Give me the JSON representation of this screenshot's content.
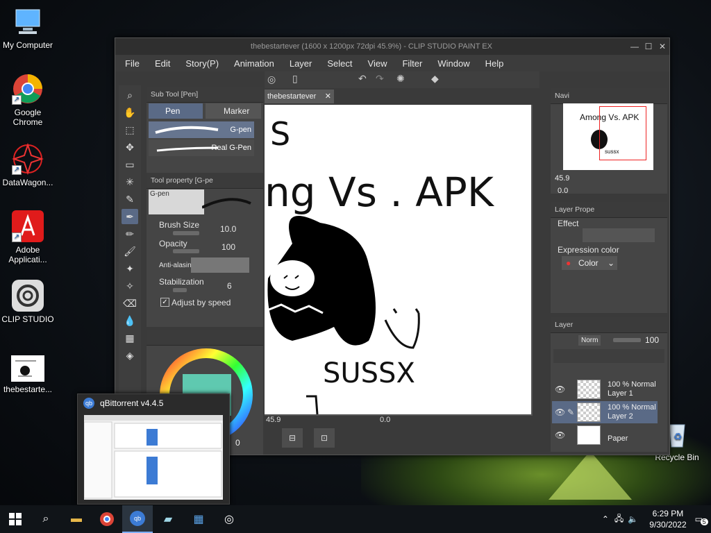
{
  "desktop": {
    "icons": [
      {
        "label": "My Computer",
        "icon": "computer-icon"
      },
      {
        "label": "Google Chrome",
        "icon": "chrome-icon"
      },
      {
        "label": "DataWagon...",
        "icon": "datawagon-icon"
      },
      {
        "label": "Adobe Applicati...",
        "icon": "adobe-icon"
      },
      {
        "label": "CLIP STUDIO",
        "icon": "clip-studio-icon"
      },
      {
        "label": "thebestarte...",
        "icon": "image-file-icon"
      },
      {
        "label": "Recycle Bin",
        "icon": "recycle-bin-icon"
      }
    ]
  },
  "window": {
    "title": "thebestartever (1600 x 1200px 72dpi 45.9%) - CLIP STUDIO PAINT EX",
    "menu": [
      "File",
      "Edit",
      "Story(P)",
      "Animation",
      "Layer",
      "Select",
      "View",
      "Filter",
      "Window",
      "Help"
    ]
  },
  "subtool": {
    "header": "Sub Tool [Pen]",
    "tabs": [
      "Pen",
      "Marker"
    ],
    "brushes": [
      "G-pen",
      "Real G-Pen"
    ]
  },
  "toolprop": {
    "header": "Tool property [G-pe",
    "brush_name": "G-pen",
    "brush_size_label": "Brush Size",
    "brush_size_value": "10.0",
    "opacity_label": "Opacity",
    "opacity_value": "100",
    "antialias_label": "Anti-alasin",
    "stabilization_label": "Stabilization",
    "stabilization_value": "6",
    "adjust_label": "Adjust by speed"
  },
  "canvas": {
    "tab": "thebestartever",
    "zoom": "45.9",
    "angle": "0.0",
    "drawing_text": [
      "S",
      "ng Vs . APK",
      "SUSSX"
    ]
  },
  "navigator": {
    "header": "Navi",
    "zoom": "45.9",
    "angle": "0.0"
  },
  "layer_property": {
    "header": "Layer Prope",
    "effect_label": "Effect",
    "expression_label": "Expression color",
    "color_button": "Color"
  },
  "layers": {
    "header": "Layer",
    "blend": "Norm",
    "opacity": "100",
    "items": [
      {
        "line1": "100 % Normal",
        "line2": "Layer 1"
      },
      {
        "line1": "100 % Normal",
        "line2": "Layer 2"
      },
      {
        "line1": "",
        "line2": "Paper"
      }
    ]
  },
  "color_panel": {
    "value": "0"
  },
  "popup": {
    "title": "qBittorrent v4.4.5"
  },
  "taskbar": {
    "time": "6:29 PM",
    "date": "9/30/2022",
    "notification_count": "5"
  }
}
